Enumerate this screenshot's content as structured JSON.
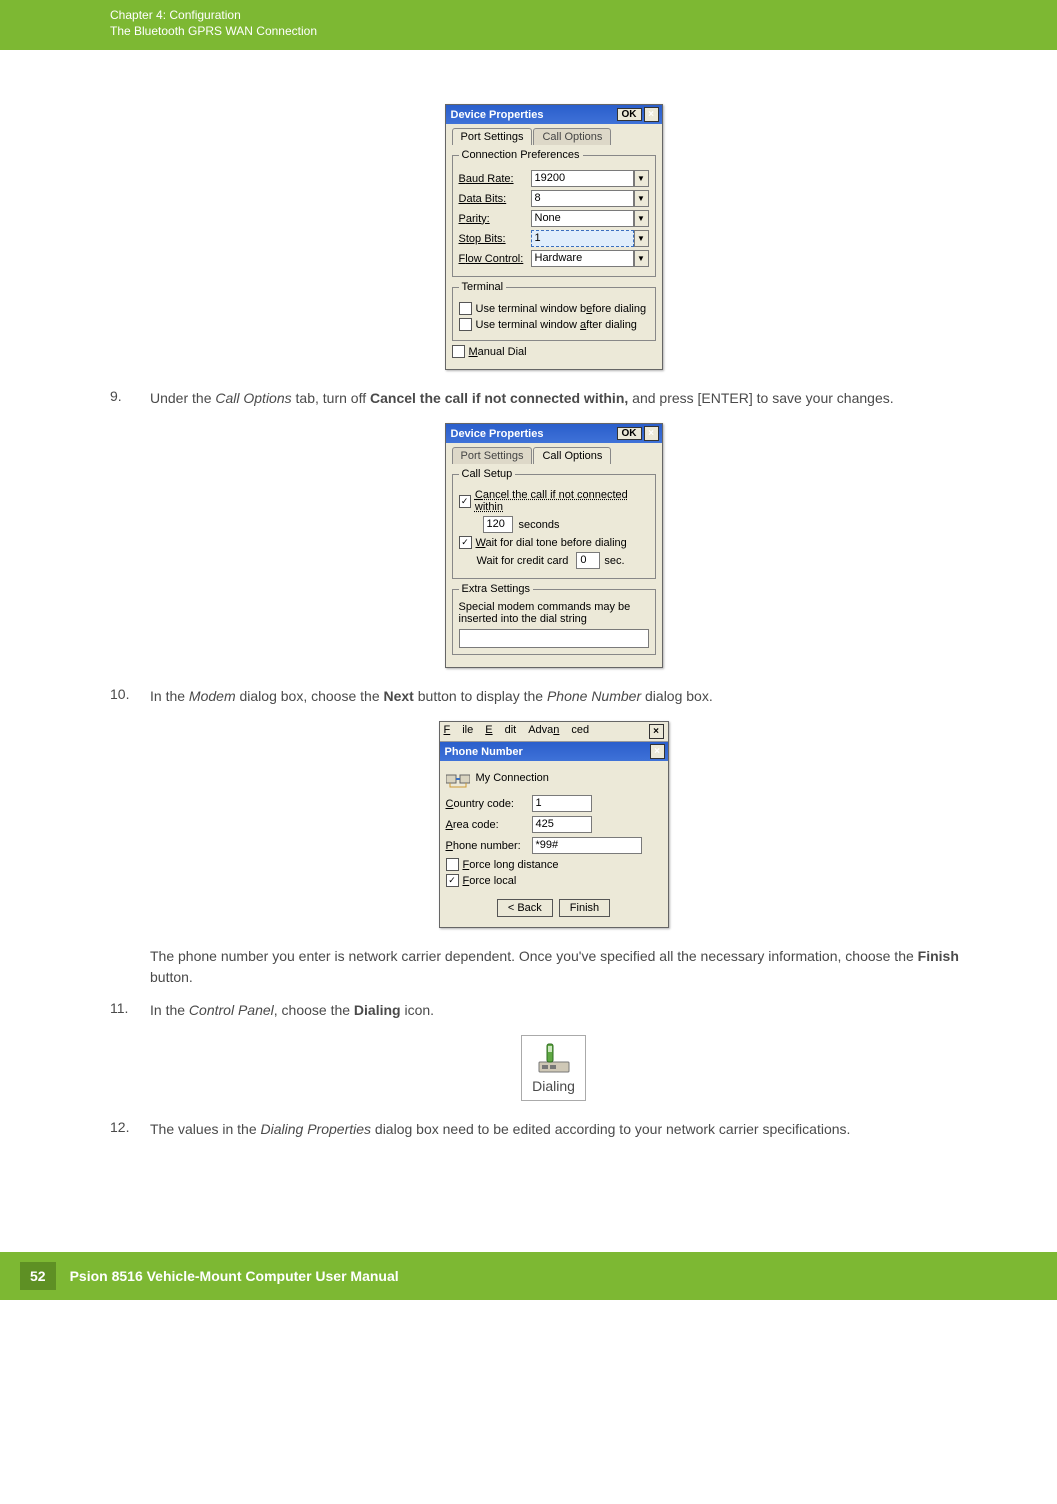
{
  "header": {
    "chapter": "Chapter 4:  Configuration",
    "subtitle": "The Bluetooth GPRS WAN Connection"
  },
  "dialog1": {
    "title": "Device Properties",
    "ok": "OK",
    "tab_port": "Port Settings",
    "tab_call": "Call Options",
    "group1": "Connection Preferences",
    "baud_label": "Baud Rate:",
    "baud_val": "19200",
    "data_label": "Data Bits:",
    "data_val": "8",
    "parity_label": "Parity:",
    "parity_val": "None",
    "stop_label": "Stop Bits:",
    "stop_val": "1",
    "flow_label": "Flow Control:",
    "flow_val": "Hardware",
    "group2": "Terminal",
    "chk_before": "Use terminal window before dialing",
    "chk_after": "Use terminal window after dialing",
    "chk_manual": "Manual Dial"
  },
  "step9": {
    "num": "9.",
    "pre": "Under the ",
    "em1": "Call Options",
    "mid1": " tab, turn off ",
    "strong1": "Cancel the call if not connected within,",
    "post": " and press [ENTER] to save your changes."
  },
  "dialog2": {
    "title": "Device Properties",
    "ok": "OK",
    "tab_port": "Port Settings",
    "tab_call": "Call Options",
    "group1": "Call Setup",
    "chk_cancel": "Cancel the call if not connected within",
    "seconds_val": "120",
    "seconds_lbl": "seconds",
    "chk_wait": "Wait for dial tone before dialing",
    "wait_credit": "Wait for credit card",
    "wait_val": "0",
    "sec": "sec.",
    "group2": "Extra Settings",
    "extra_text": "Special modem commands may be inserted into the dial string"
  },
  "step10": {
    "num": "10.",
    "pre": "In the ",
    "em1": "Modem",
    "mid1": " dialog box, choose the ",
    "strong1": "Next",
    "mid2": " button to display the ",
    "em2": "Phone Number",
    "post": " dialog box."
  },
  "dialog3": {
    "menu_file": "File",
    "menu_edit": "Edit",
    "menu_adv": "Advanced",
    "title": "Phone Number",
    "conn": "My Connection",
    "country_lbl": "Country code:",
    "country_val": "1",
    "area_lbl": "Area code:",
    "area_val": "425",
    "phone_lbl": "Phone number:",
    "phone_val": "*99#",
    "chk_long": "Force long distance",
    "chk_local": "Force local",
    "back": "< Back",
    "finish": "Finish"
  },
  "para1": {
    "pre": "The phone number you enter is network carrier dependent. Once you've specified all the necessary information, choose the ",
    "strong": "Finish",
    "post": " button."
  },
  "step11": {
    "num": "11.",
    "pre": "In the ",
    "em1": "Control Panel",
    "mid1": ", choose the ",
    "strong1": "Dialing",
    "post": " icon."
  },
  "dialing_icon": {
    "label": "Dialing"
  },
  "step12": {
    "num": "12.",
    "pre": "The values in the ",
    "em1": "Dialing Properties",
    "post": " dialog box need to be edited according to your network carrier specifications."
  },
  "footer": {
    "page": "52",
    "title": "Psion 8516 Vehicle-Mount Computer User Manual"
  }
}
